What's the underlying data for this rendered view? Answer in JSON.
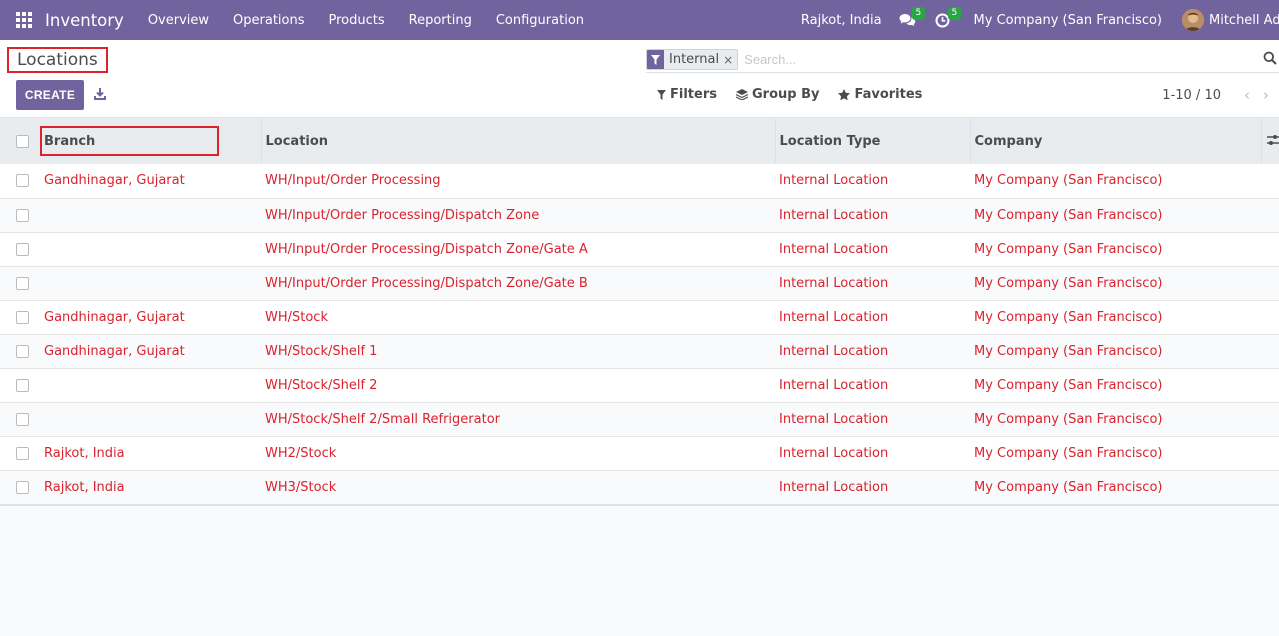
{
  "navbar": {
    "app_name": "Inventory",
    "menu": [
      "Overview",
      "Operations",
      "Products",
      "Reporting",
      "Configuration"
    ],
    "branch": "Rajkot, India",
    "messages_count": "5",
    "activities_count": "5",
    "company": "My Company (San Francisco)",
    "user": "Mitchell Admin"
  },
  "control_panel": {
    "breadcrumb": "Locations",
    "create_label": "CREATE",
    "search": {
      "facet_value": "Internal",
      "facet_remove": "×",
      "placeholder": "Search..."
    },
    "filters_label": "Filters",
    "groupby_label": "Group By",
    "favorites_label": "Favorites",
    "pager": "1-10 / 10",
    "pager_prev": "‹",
    "pager_next": "›"
  },
  "table": {
    "columns": [
      "Branch",
      "Location",
      "Location Type",
      "Company"
    ],
    "rows": [
      {
        "branch": "Gandhinagar, Gujarat",
        "location": "WH/Input/Order Processing",
        "type": "Internal Location",
        "company": "My Company (San Francisco)"
      },
      {
        "branch": "",
        "location": "WH/Input/Order Processing/Dispatch Zone",
        "type": "Internal Location",
        "company": "My Company (San Francisco)"
      },
      {
        "branch": "",
        "location": "WH/Input/Order Processing/Dispatch Zone/Gate A",
        "type": "Internal Location",
        "company": "My Company (San Francisco)"
      },
      {
        "branch": "",
        "location": "WH/Input/Order Processing/Dispatch Zone/Gate B",
        "type": "Internal Location",
        "company": "My Company (San Francisco)"
      },
      {
        "branch": "Gandhinagar, Gujarat",
        "location": "WH/Stock",
        "type": "Internal Location",
        "company": "My Company (San Francisco)"
      },
      {
        "branch": "Gandhinagar, Gujarat",
        "location": "WH/Stock/Shelf 1",
        "type": "Internal Location",
        "company": "My Company (San Francisco)"
      },
      {
        "branch": "",
        "location": "WH/Stock/Shelf 2",
        "type": "Internal Location",
        "company": "My Company (San Francisco)"
      },
      {
        "branch": "",
        "location": "WH/Stock/Shelf 2/Small Refrigerator",
        "type": "Internal Location",
        "company": "My Company (San Francisco)"
      },
      {
        "branch": "Rajkot, India",
        "location": "WH2/Stock",
        "type": "Internal Location",
        "company": "My Company (San Francisco)"
      },
      {
        "branch": "Rajkot, India",
        "location": "WH3/Stock",
        "type": "Internal Location",
        "company": "My Company (San Francisco)"
      }
    ]
  },
  "colors": {
    "brand": "#71639e",
    "link": "#d9232d",
    "badge": "#28a745"
  }
}
